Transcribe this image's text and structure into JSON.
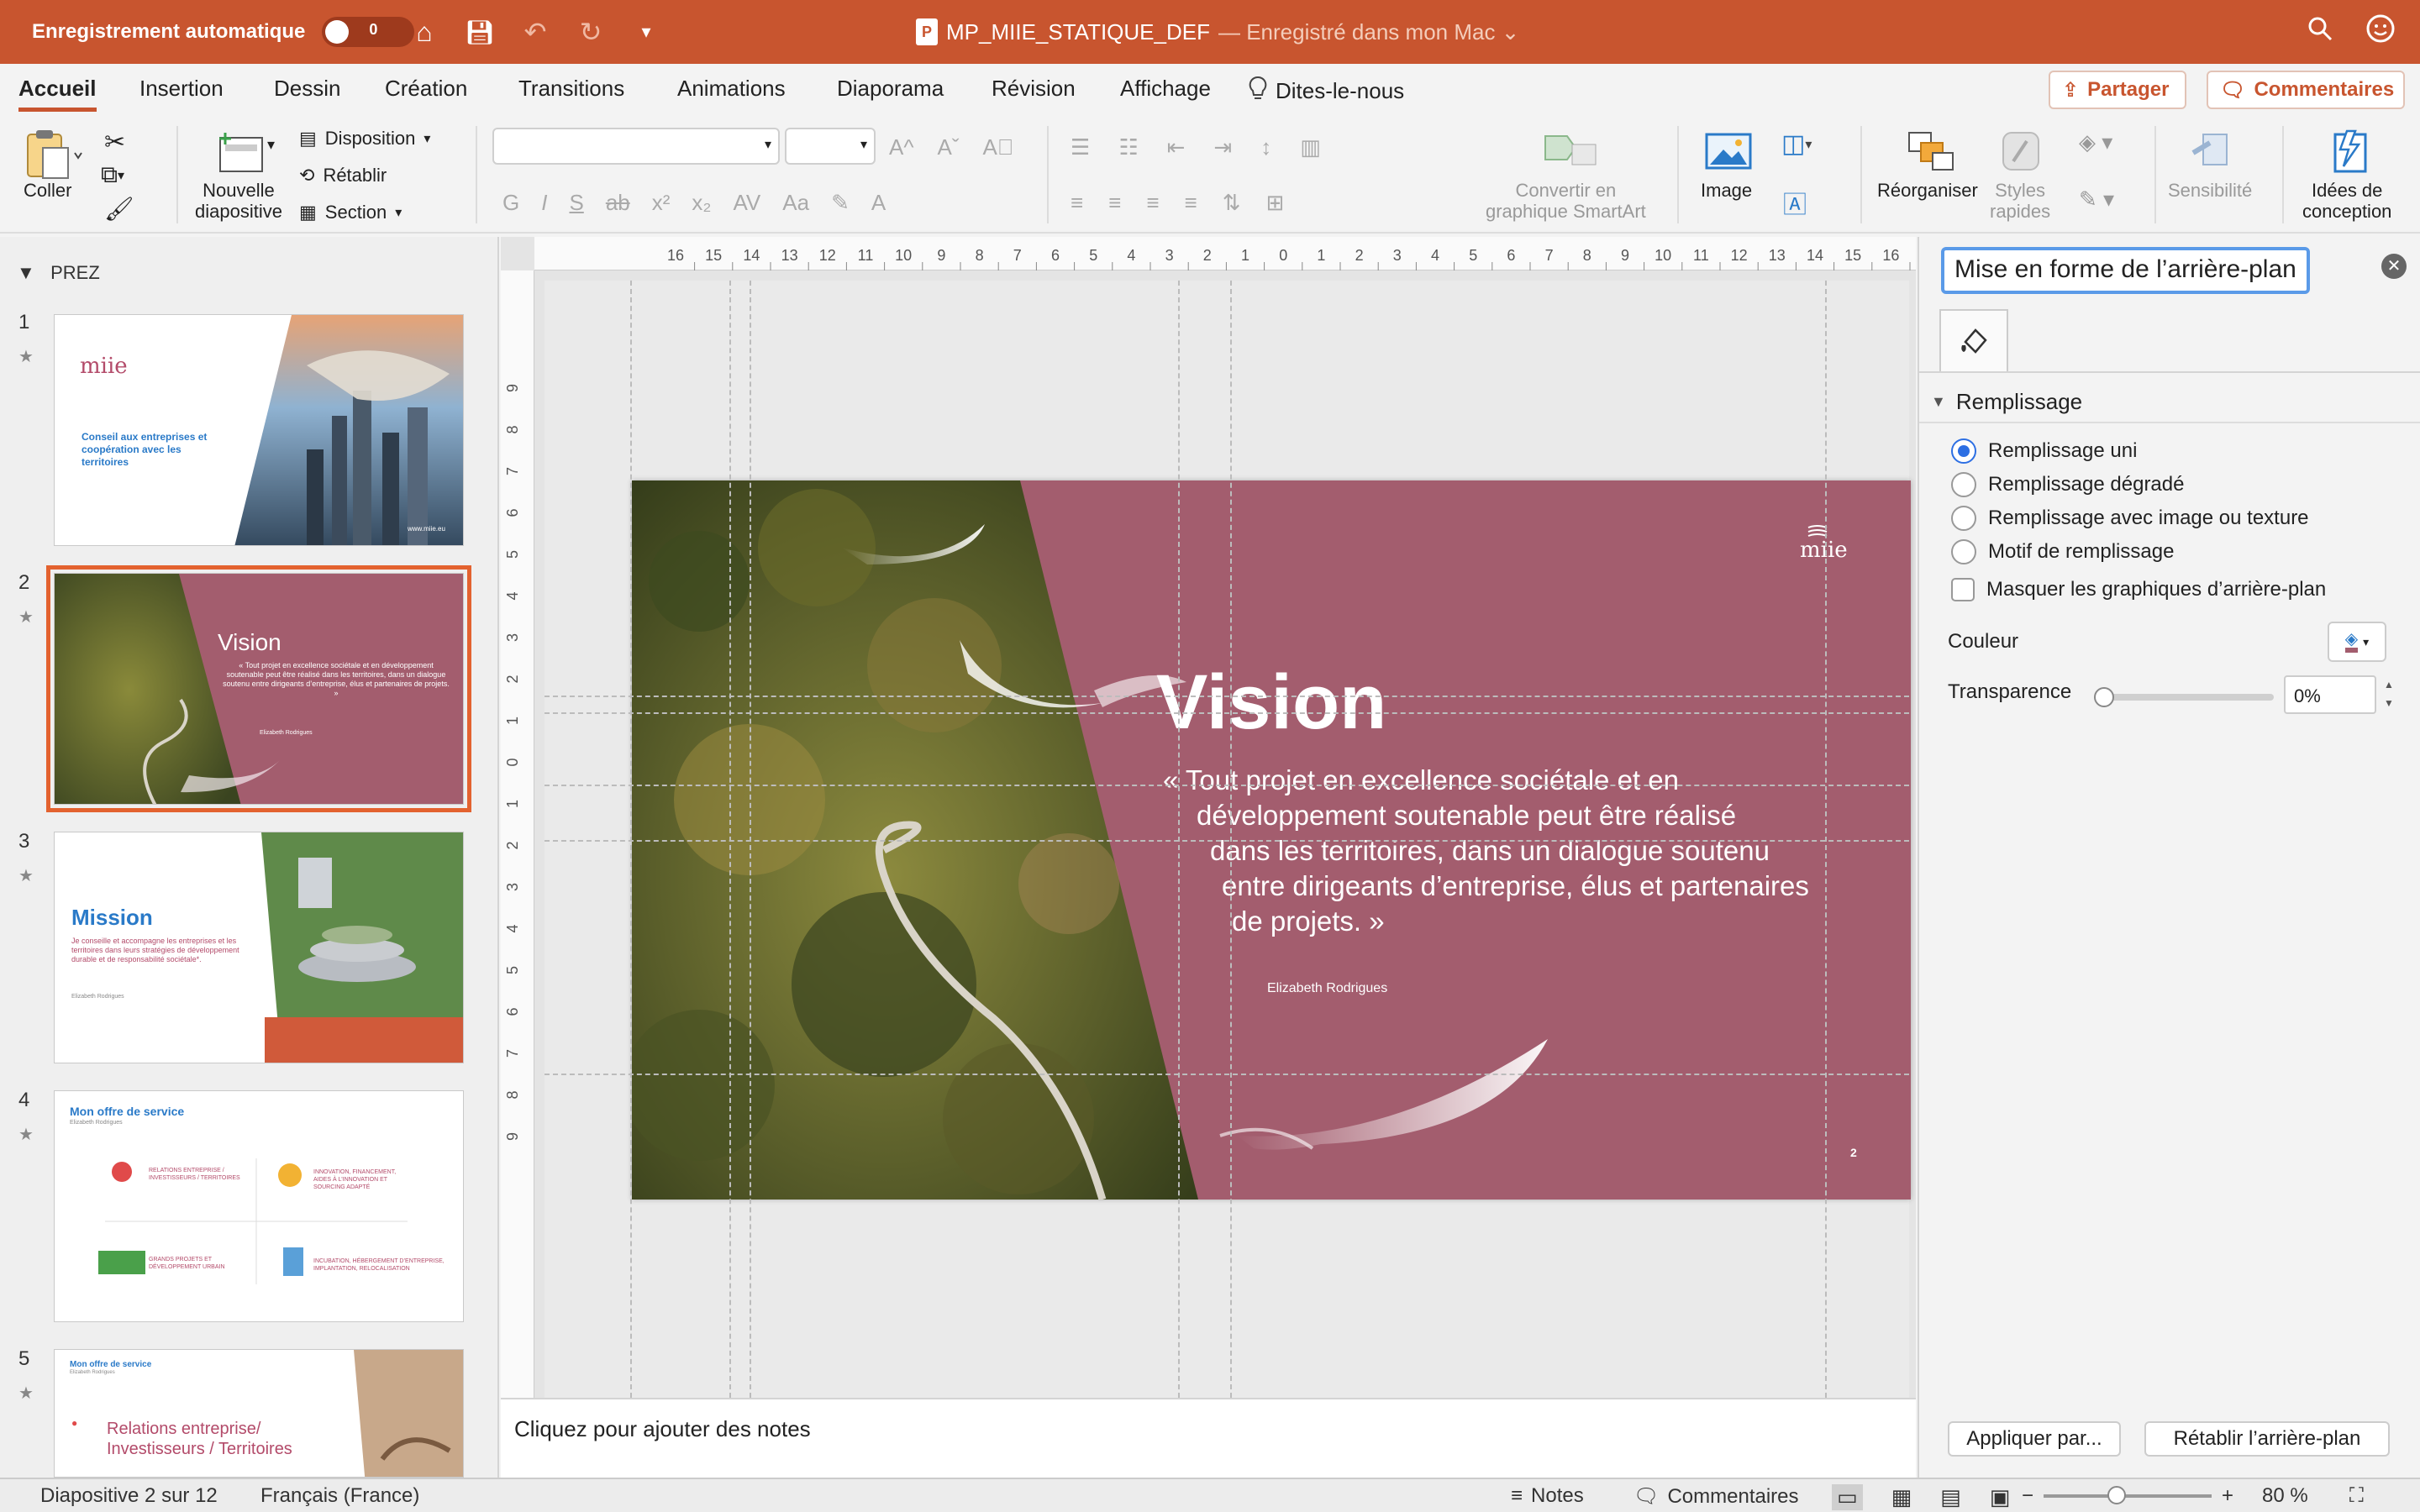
{
  "titlebar": {
    "autosave_label": "Enregistrement automatique",
    "autosave_state": "0",
    "doc_name": "MP_MIIE_STATIQUE_DEF",
    "saved_status": "— Enregistré dans mon Mac ⌄",
    "accent_color": "#c8552f"
  },
  "tabs": [
    "Accueil",
    "Insertion",
    "Dessin",
    "Création",
    "Transitions",
    "Animations",
    "Diaporama",
    "Révision",
    "Affichage"
  ],
  "tellme": "Dites-le-nous",
  "share_label": "Partager",
  "comments_label": "Commentaires",
  "ribbon": {
    "paste": "Coller",
    "new_slide_1": "Nouvelle",
    "new_slide_2": "diapositive",
    "layout": "Disposition",
    "reset": "Rétablir",
    "section": "Section",
    "smartart_1": "Convertir en",
    "smartart_2": "graphique SmartArt",
    "image": "Image",
    "arrange": "Réorganiser",
    "styles_1": "Styles",
    "styles_2": "rapides",
    "sensitivity": "Sensibilité",
    "ideas_1": "Idées de",
    "ideas_2": "conception",
    "font_buttons": [
      "G",
      "I",
      "S",
      "ab",
      "x²",
      "x₂",
      "AV",
      "Aa"
    ]
  },
  "thumbnails": {
    "section_name": "PREZ",
    "slides": [
      {
        "num": "1",
        "brand": "miie",
        "text": "Conseil aux entreprises et coopération avec les territoires",
        "site": "www.miie.eu"
      },
      {
        "num": "2",
        "title": "Vision",
        "text": "« Tout projet en excellence sociétale et en développement soutenable peut être réalisé dans les territoires, dans un dialogue soutenu entre dirigeants d’entreprise, élus et partenaires de projets. »",
        "author": "Elizabeth Rodrigues"
      },
      {
        "num": "3",
        "title": "Mission",
        "text": "Je conseille et accompagne les entreprises et les territoires dans leurs stratégies de développement durable et de responsabilité sociétale*.",
        "author": "Elizabeth Rodrigues"
      },
      {
        "num": "4",
        "title": "Mon offre de service",
        "author": "Elizabeth Rodrigues",
        "items": [
          "RELATIONS ENTREPRISE / INVESTISSEURS / TERRITOIRES",
          "INNOVATION, FINANCEMENT, AIDES À L’INNOVATION ET SOURCING ADAPTÉ",
          "GRANDS PROJETS ET DÉVELOPPEMENT URBAIN",
          "INCUBATION, HÉBERGEMENT D’ENTREPRISE, IMPLANTATION, RELOCALISATION"
        ]
      },
      {
        "num": "5",
        "title": "Mon offre de service",
        "author": "Elizabeth Rodrigues",
        "text": "Relations entreprise/ Investisseurs / Territoires"
      }
    ]
  },
  "slide": {
    "title": "Vision",
    "quote_lines": [
      "« Tout projet en excellence sociétale et en",
      "développement soutenable peut être réalisé",
      "dans les territoires, dans un dialogue soutenu",
      "entre dirigeants d’entreprise, élus et partenaires",
      "de projets. »"
    ],
    "author": "Elizabeth Rodrigues",
    "logo": "miie",
    "page_number": "2",
    "bg_color": "#a35d6e"
  },
  "notes_placeholder": "Cliquez pour ajouter des notes",
  "format_pane": {
    "title": "Mise en forme de l’arrière-plan",
    "section": "Remplissage",
    "options": [
      "Remplissage uni",
      "Remplissage dégradé",
      "Remplissage avec image ou texture",
      "Motif de remplissage"
    ],
    "selected_option": "Remplissage uni",
    "hide_graphics": "Masquer les graphiques d’arrière-plan",
    "color_label": "Couleur",
    "transparency_label": "Transparence",
    "transparency_value": "0%",
    "apply_button": "Appliquer par...",
    "reset_button": "Rétablir l’arrière-plan"
  },
  "status": {
    "slide_info": "Diapositive 2 sur 12",
    "language": "Français (France)",
    "notes": "Notes",
    "comments": "Commentaires",
    "zoom": "80 %"
  },
  "ruler_h": [
    "16",
    "15",
    "14",
    "13",
    "12",
    "11",
    "10",
    "9",
    "8",
    "7",
    "6",
    "5",
    "4",
    "3",
    "2",
    "1",
    "0",
    "1",
    "2",
    "3",
    "4",
    "5",
    "6",
    "7",
    "8",
    "9",
    "10",
    "11",
    "12",
    "13",
    "14",
    "15",
    "16"
  ],
  "ruler_v": [
    "9",
    "8",
    "7",
    "6",
    "5",
    "4",
    "3",
    "2",
    "1",
    "0",
    "1",
    "2",
    "3",
    "4",
    "5",
    "6",
    "7",
    "8",
    "9"
  ]
}
